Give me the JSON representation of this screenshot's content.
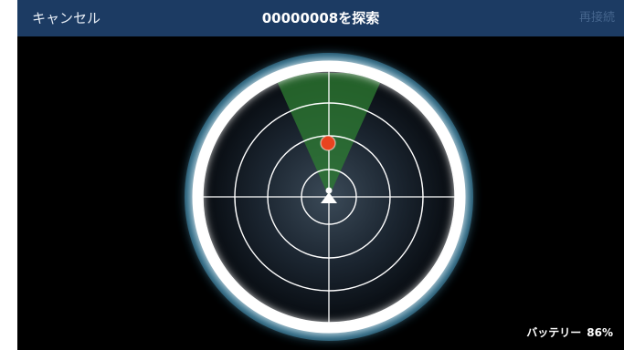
{
  "navbar": {
    "cancel_label": "キャンセル",
    "title": "00000008を探索",
    "reconnect_label": "再接続"
  },
  "status": {
    "battery_label": "バッテリー",
    "battery_value": "86%"
  },
  "radar": {
    "ring_count": 4,
    "scan_sector_color": "#2e7d32",
    "target_color": "#e8431f",
    "user_marker_color": "#ffffff",
    "ring_glow_color": "#4fc3f7"
  },
  "colors": {
    "navbar_bg": "#1c3b63",
    "screen_bg": "#000000"
  }
}
